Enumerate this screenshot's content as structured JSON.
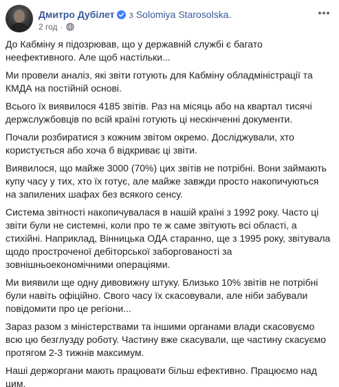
{
  "post": {
    "author": "Дмитро Дубілет",
    "with_text": "з",
    "tagged_user": "Solomiya Starosolska.",
    "time": "2 год",
    "dot": "·",
    "paragraphs": [
      "До Кабміну я підозрював, що у державній службі є багато неефективного. Але щоб настільки...",
      "Ми провели аналіз, які звіти готують для Кабміну обладміністрації та КМДА на постійній основі.",
      "Всього їх виявилося 4185 звітів. Раз на місяць або на квартал тисячі держслужбовців по всій країні готують ці нескінченні документи.",
      "Почали розбиратися з кожним звітом окремо. Досліджували, хто користується або хоча б відкриває ці звіти.",
      "Виявилося, що майже 3000 (70%) цих звітів не потрібні. Вони займають купу часу у тих, хто їх готує, але майже завжди просто накопичуються на запилених шафах без всякого сенсу.",
      "Система звітності накопичувалася в нашій країні з 1992 року. Часто ці звіти були не системні, коли про те ж саме звітують всі області, а стихійні. Наприклад, Вінницька ОДА старанно, ще з 1995 року, звітувала щодо простроченої дебіторської заборгованості за зовнішньоекономічними операціями.",
      "Ми виявили ще одну дивовижну штуку. Близько 10% звітів не потрібні були навіть офіційно. Свого часу їх скасовували, але ніби забували повідомити про це регіони...",
      "Зараз разом з міністерствами та іншими органами влади скасовуємо всю цю безглузду роботу. Частину вже скасували, ще частину скасуємо протягом 2-3 тижнів максимум.",
      "Наші держоргани мають працювати більш ефективно. Працюємо над цим."
    ]
  },
  "icons": {
    "verified": "verified-badge-icon",
    "audience": "globe-icon",
    "more": "more-options-icon"
  },
  "colors": {
    "link": "#385898",
    "verified": "#4080ff",
    "text": "#1c1e21",
    "meta": "#616770"
  }
}
